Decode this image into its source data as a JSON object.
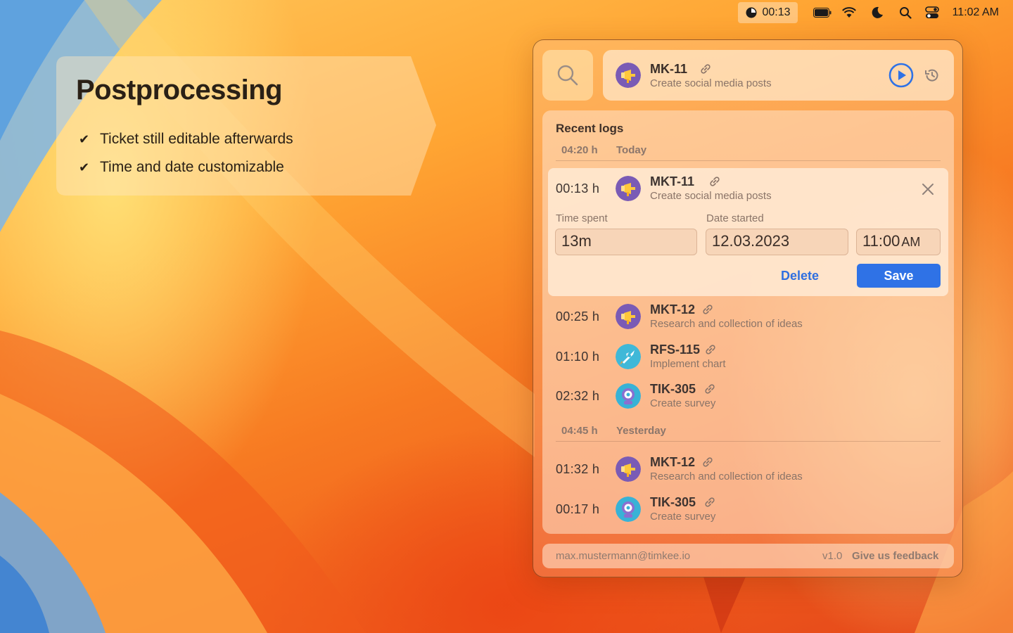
{
  "menubar": {
    "timer": "00:13",
    "clock": "11:02 AM",
    "icons": [
      "timer-icon",
      "battery-icon",
      "wifi-icon",
      "moon-icon",
      "spotlight-search-icon",
      "control-center-icon"
    ]
  },
  "callout": {
    "title": "Postprocessing",
    "features": [
      "Ticket still editable afterwards",
      "Time and date customizable"
    ]
  },
  "current": {
    "ticket_id": "MK-11",
    "description": "Create social media posts"
  },
  "logs": {
    "title": "Recent logs",
    "groups": [
      {
        "total": "04:20 h",
        "day": "Today",
        "entries": [
          {
            "duration": "00:13 h",
            "ticket_id": "MKT-11",
            "description": "Create social media posts",
            "avatar": "marketing"
          },
          {
            "duration": "00:25 h",
            "ticket_id": "MKT-12",
            "description": "Research and collection of ideas",
            "avatar": "marketing"
          },
          {
            "duration": "01:10 h",
            "ticket_id": "RFS-115",
            "description": "Implement chart",
            "avatar": "rocket"
          },
          {
            "duration": "02:32 h",
            "ticket_id": "TIK-305",
            "description": "Create survey",
            "avatar": "robot"
          }
        ]
      },
      {
        "total": "04:45 h",
        "day": "Yesterday",
        "entries": [
          {
            "duration": "01:32 h",
            "ticket_id": "MKT-12",
            "description": "Research and collection of ideas",
            "avatar": "marketing"
          },
          {
            "duration": "00:17 h",
            "ticket_id": "TIK-305",
            "description": "Create survey",
            "avatar": "robot"
          }
        ]
      }
    ],
    "editor": {
      "time_spent_label": "Time spent",
      "time_spent_value": "13m",
      "date_started_label": "Date started",
      "date_value": "12.03.2023",
      "time_value": "11:00",
      "time_ampm": "AM",
      "delete_label": "Delete",
      "save_label": "Save"
    }
  },
  "footer": {
    "user": "max.mustermann@timkee.io",
    "version": "v1.0",
    "feedback": "Give us feedback"
  },
  "colors": {
    "accent": "#2f72e6",
    "marketing_avatar": "#7a5bb5",
    "rocket_avatar": "#3fb8d8",
    "robot_avatar": "#38b2d6"
  }
}
